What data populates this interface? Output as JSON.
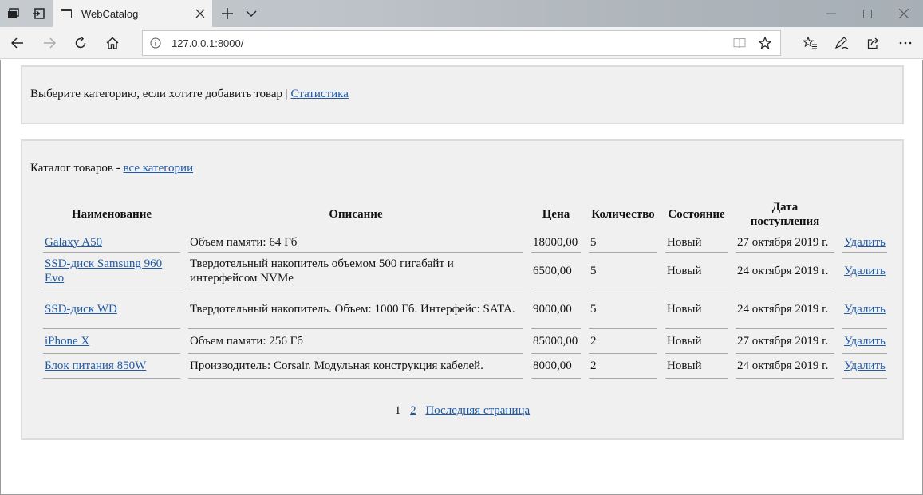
{
  "browser": {
    "tab_title": "WebCatalog",
    "url": "127.0.0.1:8000/"
  },
  "top_panel": {
    "prompt": "Выберите категорию, если хотите добавить товар",
    "separator": "|",
    "stats_link": "Статистика"
  },
  "catalog": {
    "heading": "Каталог товаров -",
    "all_categories_link": "все категории",
    "columns": [
      "Наименование",
      "Описание",
      "Цена",
      "Количество",
      "Состояние",
      "Дата поступления",
      ""
    ],
    "rows": [
      {
        "name": "Galaxy A50",
        "description": "Объем памяти: 64 Гб",
        "price": "18000,00",
        "quantity": "5",
        "state": "Новый",
        "date": "27 октября 2019 г.",
        "action": "Удалить"
      },
      {
        "name": "SSD-диск Samsung 960 Evo",
        "description": "Твердотельный накопитель объемом 500 гигабайт и интерфейсом NVMe",
        "price": "6500,00",
        "quantity": "5",
        "state": "Новый",
        "date": "24 октября 2019 г.",
        "action": "Удалить"
      },
      {
        "name": "SSD-диск WD",
        "description": "Твердотельный накопитель. Объем: 1000 Гб. Интерфейс: SATA.",
        "price": "9000,00",
        "quantity": "5",
        "state": "Новый",
        "date": "24 октября 2019 г.",
        "action": "Удалить"
      },
      {
        "name": "iPhone X",
        "description": "Объем памяти: 256 Гб",
        "price": "85000,00",
        "quantity": "2",
        "state": "Новый",
        "date": "27 октября 2019 г.",
        "action": "Удалить"
      },
      {
        "name": "Блок питания 850W",
        "description": "Производитель: Corsair. Модульная конструкция кабелей.",
        "price": "8000,00",
        "quantity": "2",
        "state": "Новый",
        "date": "24 октября 2019 г.",
        "action": "Удалить"
      }
    ],
    "pagination": {
      "current": "1",
      "next": "2",
      "last": "Последняя страница"
    }
  },
  "colors": {
    "link": "#1f5aa6",
    "panel_bg": "#f0f0f0",
    "panel_border": "#dcdcdc"
  }
}
